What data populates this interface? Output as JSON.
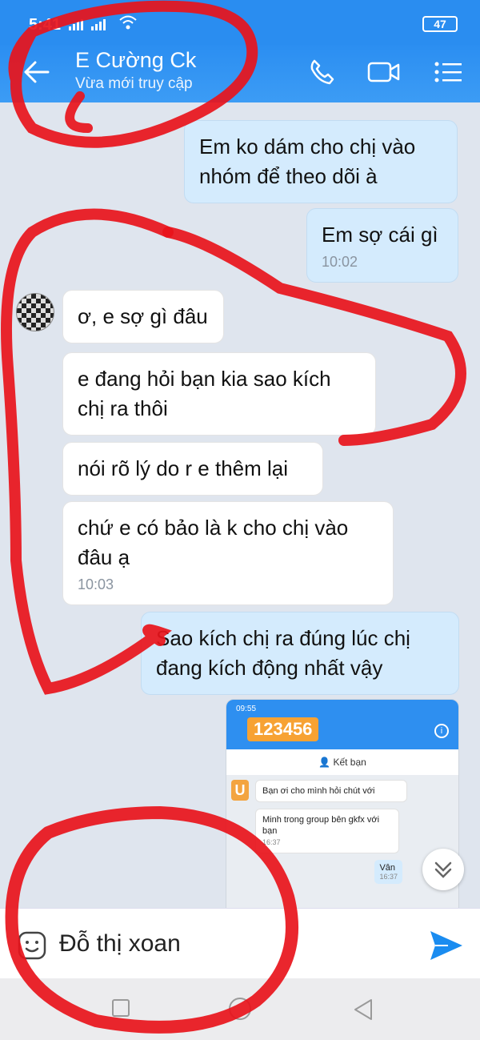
{
  "status_bar": {
    "time": "5:41",
    "signal": "all all",
    "battery": "47"
  },
  "header": {
    "contact_name": "E Cường Ck",
    "contact_status": "Vừa mới truy cập"
  },
  "messages": [
    {
      "side": "sent",
      "text": "Em ko dám cho chị vào nhóm để theo dõi à"
    },
    {
      "side": "sent",
      "text": "Em sợ cái gì",
      "time": "10:02"
    },
    {
      "side": "received",
      "text": "ơ, e sợ gì đâu"
    },
    {
      "side": "received",
      "text": "e đang hỏi bạn kia sao kích chị ra thôi"
    },
    {
      "side": "received",
      "text": "nói rõ lý do r e thêm lại"
    },
    {
      "side": "received",
      "text": "chứ e có bảo là k cho chị vào đâu ạ",
      "time": "10:03"
    },
    {
      "side": "sent",
      "text": "Sao kích chị ra đúng lúc chị đang kích động nhất vậy"
    }
  ],
  "shared_screenshot": {
    "status": "09:55",
    "title": "123456",
    "add_friend": "Kết bạn",
    "avatar_letter": "U",
    "msg1": "Bạn ơi cho mình hỏi chút với",
    "msg2": "Minh trong group bên gkfx với bạn",
    "msg2_time": "16:37",
    "reply": "Vân",
    "reply_time": "16:37"
  },
  "composer": {
    "value": "Đỗ thị xoan"
  },
  "colors": {
    "header": "#2a8df0",
    "sent_bubble": "#d4ebfd",
    "received_bubble": "#ffffff",
    "marker": "#e8131b"
  }
}
